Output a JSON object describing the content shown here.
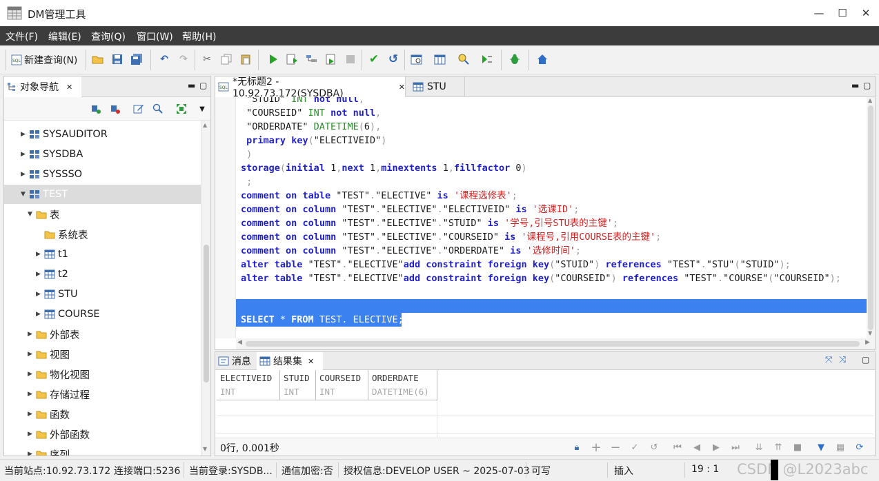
{
  "window": {
    "title": "DM管理工具",
    "minimize_icon": "—",
    "maximize_icon": "☐",
    "close_icon": "✕"
  },
  "menu": [
    "文件(F)",
    "编辑(E)",
    "查询(Q)",
    "窗口(W)",
    "帮助(H)"
  ],
  "toolbar": {
    "new_query_label": "新建查询(N)",
    "icons": [
      "sql-icon",
      "open-folder-icon",
      "save-icon",
      "save-all-icon",
      "undo-icon",
      "redo-icon",
      "cut-icon",
      "copy-icon",
      "paste-icon",
      "run-icon",
      "run-script-icon",
      "explain-icon",
      "run-step-icon",
      "stop-icon",
      "commit-icon",
      "rollback-icon",
      "schedule-icon",
      "table-schedule-icon",
      "debug-search-icon",
      "execute-plan-icon",
      "bug-icon",
      "home-icon"
    ]
  },
  "navigator": {
    "tab_label": "对象导航",
    "close_icon": "✕",
    "tree": [
      {
        "label": "SYSAUDITOR",
        "level": 1,
        "expanded": false,
        "kind": "schema"
      },
      {
        "label": "SYSDBA",
        "level": 1,
        "expanded": false,
        "kind": "schema"
      },
      {
        "label": "SYSSSO",
        "level": 1,
        "expanded": false,
        "kind": "schema"
      },
      {
        "label": "TEST",
        "level": 1,
        "expanded": true,
        "kind": "schema",
        "selected": true
      },
      {
        "label": "表",
        "level": 2,
        "expanded": true,
        "kind": "folder"
      },
      {
        "label": "系统表",
        "level": 3,
        "expanded": null,
        "kind": "folder"
      },
      {
        "label": "t1",
        "level": 3,
        "expanded": false,
        "kind": "table"
      },
      {
        "label": "t2",
        "level": 3,
        "expanded": false,
        "kind": "table"
      },
      {
        "label": "STU",
        "level": 3,
        "expanded": false,
        "kind": "table"
      },
      {
        "label": "COURSE",
        "level": 3,
        "expanded": false,
        "kind": "table"
      },
      {
        "label": "外部表",
        "level": 2,
        "expanded": false,
        "kind": "folder"
      },
      {
        "label": "视图",
        "level": 2,
        "expanded": false,
        "kind": "folder"
      },
      {
        "label": "物化视图",
        "level": 2,
        "expanded": false,
        "kind": "folder"
      },
      {
        "label": "存储过程",
        "level": 2,
        "expanded": false,
        "kind": "folder"
      },
      {
        "label": "函数",
        "level": 2,
        "expanded": false,
        "kind": "folder"
      },
      {
        "label": "外部函数",
        "level": 2,
        "expanded": false,
        "kind": "folder"
      },
      {
        "label": "序列",
        "level": 2,
        "expanded": false,
        "kind": "folder"
      }
    ]
  },
  "editor": {
    "tabs": [
      {
        "label": "*无标题2 - 10.92.73.172(SYSDBA)",
        "active": true
      },
      {
        "label": "STU",
        "active": false
      }
    ],
    "close_icon": "✕",
    "code_lines": [
      " \"STUID\" INT not null,",
      " \"COURSEID\" INT not null,",
      " \"ORDERDATE\" DATETIME(6),",
      " primary key(\"ELECTIVEID\")",
      " )",
      "storage(initial 1,next 1,minextents 1,fillfactor 0)",
      " ;",
      "comment on table \"TEST\".\"ELECTIVE\" is '课程选修表';",
      "comment on column \"TEST\".\"ELECTIVE\".\"ELECTIVEID\" is '选课ID';",
      "comment on column \"TEST\".\"ELECTIVE\".\"STUID\" is '学号,引号STU表的主键';",
      "comment on column \"TEST\".\"ELECTIVE\".\"COURSEID\" is '课程号,引用COURSE表的主键';",
      "comment on column \"TEST\".\"ELECTIVE\".\"ORDERDATE\" is '选修时间';",
      "alter table \"TEST\".\"ELECTIVE\"add constraint foreign key(\"STUID\") references \"TEST\".\"STU\"(\"STUID\");",
      "alter table \"TEST\".\"ELECTIVE\"add constraint foreign key(\"COURSEID\") references \"TEST\".\"COURSE\"(\"COURSEID\");",
      "",
      "",
      "SELECT * FROM TEST. ELECTIVE;"
    ]
  },
  "results": {
    "tabs": [
      {
        "label": "消息",
        "active": false
      },
      {
        "label": "结果集",
        "active": true
      }
    ],
    "columns": [
      {
        "name": "ELECTIVEID",
        "type": "INT"
      },
      {
        "name": "STUID",
        "type": "INT"
      },
      {
        "name": "COURSEID",
        "type": "INT"
      },
      {
        "name": "ORDERDATE",
        "type": "DATETIME(6)"
      }
    ],
    "rows": [],
    "status_text": "0行, 0.001秒"
  },
  "statusbar": {
    "site": "当前站点:10.92.73.172",
    "port": "连接端口:5236",
    "login": "当前登录:SYSDB...",
    "encrypt": "通信加密:否",
    "license": "授权信息:DEVELOP USER ~ 2025-07-03",
    "writable": "可写",
    "insert_mode": "插入",
    "position": "19 : 1",
    "watermark": "CSDN @L2023abc"
  }
}
